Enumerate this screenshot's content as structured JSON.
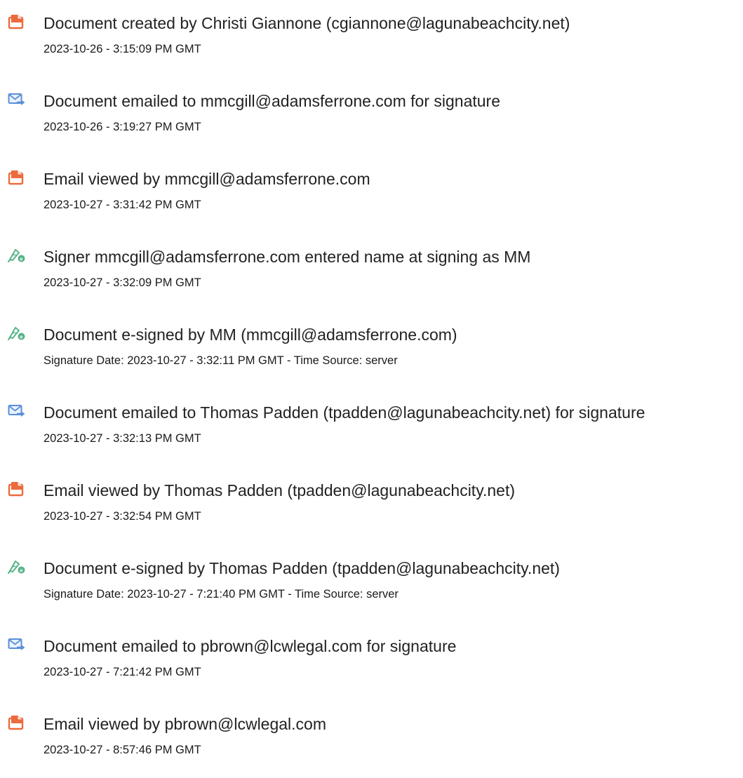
{
  "colors": {
    "doc_icon": "#ec6a3c",
    "email_icon": "#5b8fd8",
    "sign_icon": "#56b488",
    "title_text": "#222222",
    "sub_text": "#1a1a1a"
  },
  "events": [
    {
      "icon": "document-icon",
      "title": "Document created by Christi Giannone (cgiannone@lagunabeachcity.net)",
      "detail": "2023-10-26 - 3:15:09 PM GMT"
    },
    {
      "icon": "email-icon",
      "title": "Document emailed to mmcgill@adamsferrone.com for signature",
      "detail": "2023-10-26 - 3:19:27 PM GMT"
    },
    {
      "icon": "document-icon",
      "title": "Email viewed by mmcgill@adamsferrone.com",
      "detail": "2023-10-27 - 3:31:42 PM GMT"
    },
    {
      "icon": "signature-icon",
      "title": "Signer mmcgill@adamsferrone.com entered name at signing as MM",
      "detail": "2023-10-27 - 3:32:09 PM GMT"
    },
    {
      "icon": "signature-icon",
      "title": "Document e-signed by MM (mmcgill@adamsferrone.com)",
      "detail": "Signature Date: 2023-10-27 - 3:32:11 PM GMT - Time Source: server"
    },
    {
      "icon": "email-icon",
      "title": "Document emailed to Thomas Padden (tpadden@lagunabeachcity.net) for signature",
      "detail": "2023-10-27 - 3:32:13 PM GMT"
    },
    {
      "icon": "document-icon",
      "title": "Email viewed by Thomas Padden (tpadden@lagunabeachcity.net)",
      "detail": "2023-10-27 - 3:32:54 PM GMT"
    },
    {
      "icon": "signature-icon",
      "title": "Document e-signed by Thomas Padden (tpadden@lagunabeachcity.net)",
      "detail": "Signature Date: 2023-10-27 - 7:21:40 PM GMT - Time Source: server"
    },
    {
      "icon": "email-icon",
      "title": "Document emailed to pbrown@lcwlegal.com for signature",
      "detail": "2023-10-27 - 7:21:42 PM GMT"
    },
    {
      "icon": "document-icon",
      "title": "Email viewed by pbrown@lcwlegal.com",
      "detail": "2023-10-27 - 8:57:46 PM GMT"
    }
  ]
}
